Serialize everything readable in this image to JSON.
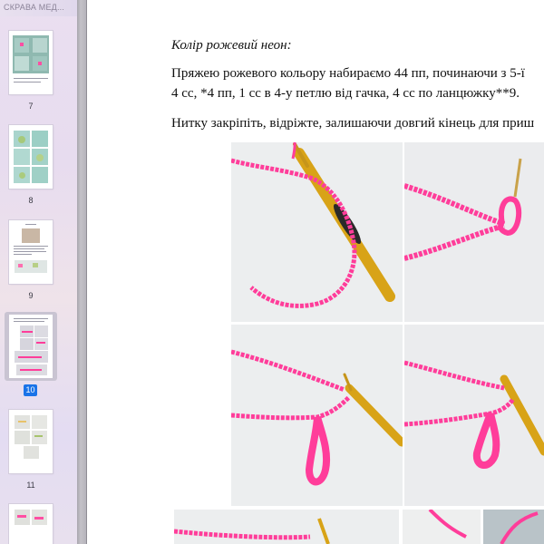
{
  "sidebar": {
    "header_title": "СКРАВА МЕД...",
    "thumbnails": [
      {
        "page": "7"
      },
      {
        "page": "8"
      },
      {
        "page": "9"
      },
      {
        "page": "10",
        "selected": true
      },
      {
        "page": "11"
      }
    ]
  },
  "document": {
    "heading": "Колір рожевий неон:",
    "line1": "Пряжею рожевого кольору набираємо 44 пп, починаючи з 5-ї",
    "line2": "4 сс, *4 пп, 1 сс в 4-у петлю від гачка, 4 сс по ланцюжку**9.",
    "line3": "Нитку закріпіть, відріжте, залишаючи довгий кінець для приш",
    "photos": [
      {
        "name": "photo-chain-with-hook"
      },
      {
        "name": "photo-loop-end"
      },
      {
        "name": "photo-second-loop"
      },
      {
        "name": "photo-third-loop"
      }
    ]
  },
  "colors": {
    "yarn_pink": "#ff3d9a",
    "hook_gold": "#d4a017",
    "selection_badge": "#1a73e8"
  }
}
